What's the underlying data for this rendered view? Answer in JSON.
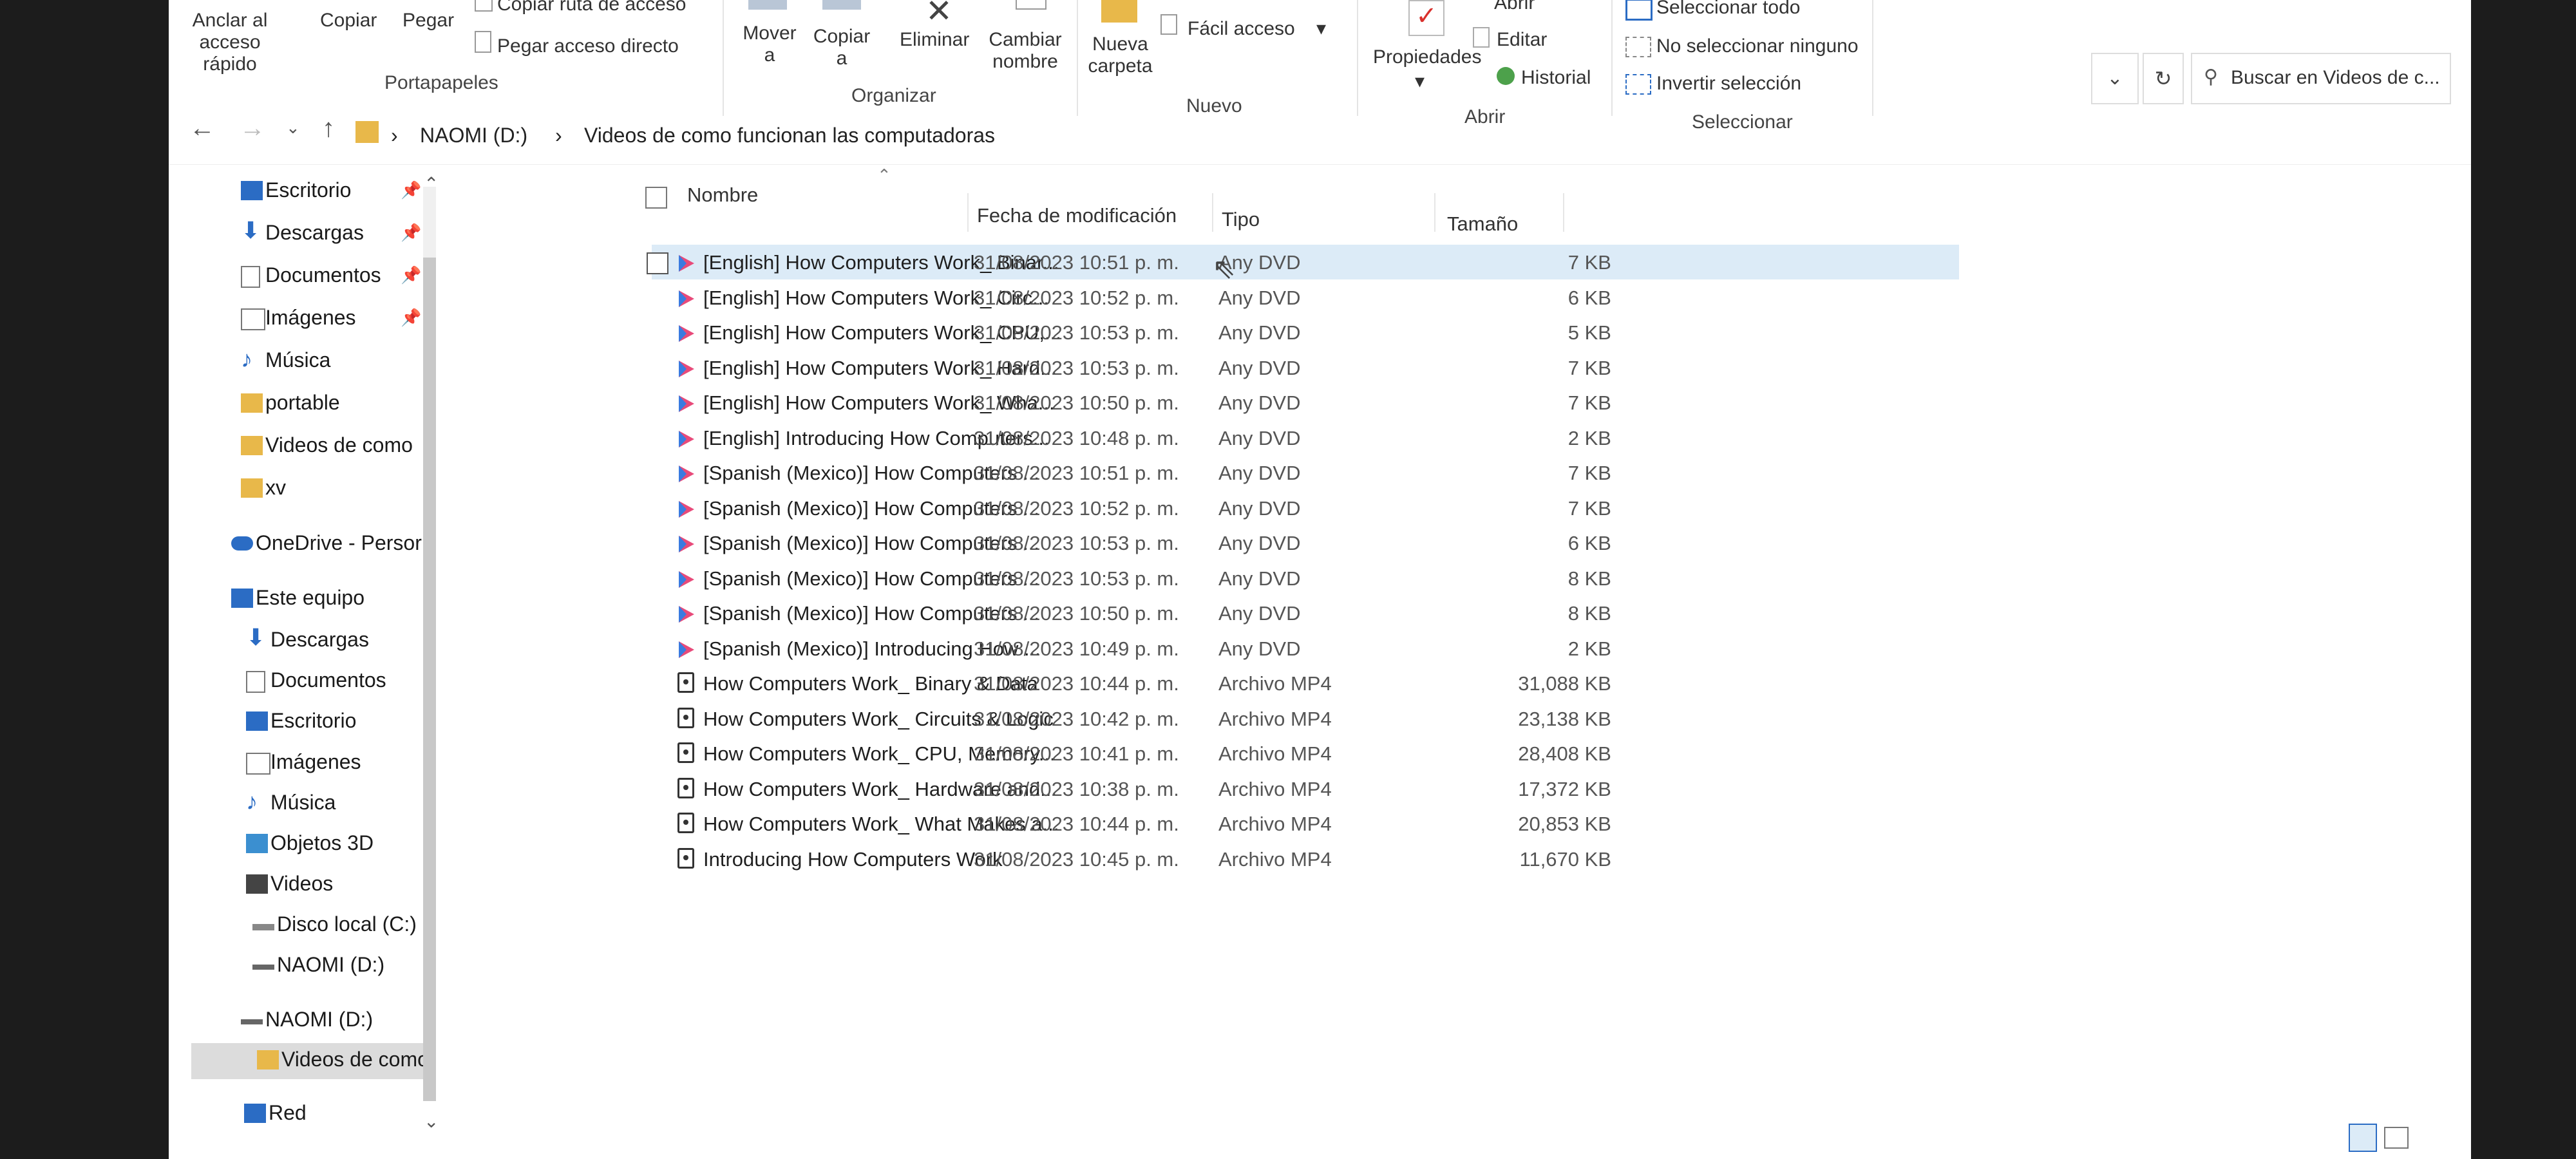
{
  "ribbon": {
    "portapapeles": {
      "anclar": "Anclar al acceso rápido",
      "copiar": "Copiar",
      "pegar": "Pegar",
      "copiar_ruta": "Copiar ruta de acceso",
      "pegar_acceso": "Pegar acceso directo",
      "group": "Portapapeles"
    },
    "organizar": {
      "mover": "Mover a",
      "copiar_a": "Copiar a",
      "eliminar": "Eliminar",
      "cambiar": "Cambiar nombre",
      "group": "Organizar"
    },
    "nuevo": {
      "nueva_carpeta": "Nueva carpeta",
      "facil_acceso": "Fácil acceso",
      "group": "Nuevo"
    },
    "abrir": {
      "propiedades": "Propiedades",
      "abrir": "Abrir",
      "editar": "Editar",
      "historial": "Historial",
      "group": "Abrir"
    },
    "seleccionar": {
      "todo": "Seleccionar todo",
      "ninguno": "No seleccionar ninguno",
      "invertir": "Invertir selección",
      "group": "Seleccionar"
    }
  },
  "address": {
    "drive": "NAOMI (D:)",
    "folder": "Videos de como funcionan las computadoras",
    "search_placeholder": "Buscar en Videos de c..."
  },
  "nav": [
    {
      "label": "Escritorio",
      "icon": "desktop-icon",
      "pinned": true
    },
    {
      "label": "Descargas",
      "icon": "download-icon",
      "pinned": true
    },
    {
      "label": "Documentos",
      "icon": "document-icon",
      "pinned": true
    },
    {
      "label": "Imágenes",
      "icon": "image-icon",
      "pinned": true
    },
    {
      "label": "Música",
      "icon": "music-icon"
    },
    {
      "label": "portable",
      "icon": "folder-icon"
    },
    {
      "label": "Videos de como",
      "icon": "folder-icon"
    },
    {
      "label": "xv",
      "icon": "folder-icon"
    },
    {
      "label": "OneDrive - Persor",
      "icon": "cloud-icon"
    },
    {
      "label": "Este equipo",
      "icon": "computer-icon"
    },
    {
      "label": "Descargas",
      "icon": "download-icon"
    },
    {
      "label": "Documentos",
      "icon": "document-icon"
    },
    {
      "label": "Escritorio",
      "icon": "desktop-icon"
    },
    {
      "label": "Imágenes",
      "icon": "image-icon"
    },
    {
      "label": "Música",
      "icon": "music-icon"
    },
    {
      "label": "Objetos 3D",
      "icon": "cube-icon"
    },
    {
      "label": "Videos",
      "icon": "video-icon"
    },
    {
      "label": "Disco local (C:)",
      "icon": "drive-icon"
    },
    {
      "label": "NAOMI (D:)",
      "icon": "drive-icon"
    },
    {
      "label": "NAOMI (D:)",
      "icon": "drive-icon"
    },
    {
      "label": "Videos de como",
      "icon": "folder-icon"
    },
    {
      "label": "Red",
      "icon": "network-icon"
    }
  ],
  "columns": {
    "name": "Nombre",
    "date": "Fecha de modificación",
    "type": "Tipo",
    "size": "Tamaño"
  },
  "files": [
    {
      "name": "[English] How Computers Work_ Binar...",
      "date": "31/08/2023 10:51 p. m.",
      "type": "Any DVD",
      "size": "7 KB",
      "kind": "dvd"
    },
    {
      "name": "[English] How Computers Work_ Circ...",
      "date": "31/08/2023 10:52 p. m.",
      "type": "Any DVD",
      "size": "6 KB",
      "kind": "dvd"
    },
    {
      "name": "[English] How Computers Work_ CPU,...",
      "date": "31/08/2023 10:53 p. m.",
      "type": "Any DVD",
      "size": "5 KB",
      "kind": "dvd"
    },
    {
      "name": "[English] How Computers Work_ Hard...",
      "date": "31/08/2023 10:53 p. m.",
      "type": "Any DVD",
      "size": "7 KB",
      "kind": "dvd"
    },
    {
      "name": "[English] How Computers Work_ Wha...",
      "date": "31/08/2023 10:50 p. m.",
      "type": "Any DVD",
      "size": "7 KB",
      "kind": "dvd"
    },
    {
      "name": "[English] Introducing How Computers...",
      "date": "31/08/2023 10:48 p. m.",
      "type": "Any DVD",
      "size": "2 KB",
      "kind": "dvd"
    },
    {
      "name": "[Spanish (Mexico)] How Computers ...",
      "date": "31/08/2023 10:51 p. m.",
      "type": "Any DVD",
      "size": "7 KB",
      "kind": "dvd"
    },
    {
      "name": "[Spanish (Mexico)] How Computers ...",
      "date": "31/08/2023 10:52 p. m.",
      "type": "Any DVD",
      "size": "7 KB",
      "kind": "dvd"
    },
    {
      "name": "[Spanish (Mexico)] How Computers ...",
      "date": "31/08/2023 10:53 p. m.",
      "type": "Any DVD",
      "size": "6 KB",
      "kind": "dvd"
    },
    {
      "name": "[Spanish (Mexico)] How Computers ...",
      "date": "31/08/2023 10:53 p. m.",
      "type": "Any DVD",
      "size": "8 KB",
      "kind": "dvd"
    },
    {
      "name": "[Spanish (Mexico)] How Computers ...",
      "date": "31/08/2023 10:50 p. m.",
      "type": "Any DVD",
      "size": "8 KB",
      "kind": "dvd"
    },
    {
      "name": "[Spanish (Mexico)] Introducing How ...",
      "date": "31/08/2023 10:49 p. m.",
      "type": "Any DVD",
      "size": "2 KB",
      "kind": "dvd"
    },
    {
      "name": "How Computers Work_ Binary & Data",
      "date": "31/08/2023 10:44 p. m.",
      "type": "Archivo MP4",
      "size": "31,088 KB",
      "kind": "mp4"
    },
    {
      "name": "How Computers Work_ Circuits & Logic",
      "date": "31/08/2023 10:42 p. m.",
      "type": "Archivo MP4",
      "size": "23,138 KB",
      "kind": "mp4"
    },
    {
      "name": "How Computers Work_ CPU, Memory...",
      "date": "31/08/2023 10:41 p. m.",
      "type": "Archivo MP4",
      "size": "28,408 KB",
      "kind": "mp4"
    },
    {
      "name": "How Computers Work_ Hardware and...",
      "date": "31/08/2023 10:38 p. m.",
      "type": "Archivo MP4",
      "size": "17,372 KB",
      "kind": "mp4"
    },
    {
      "name": "How Computers Work_ What Makes a...",
      "date": "31/08/2023 10:44 p. m.",
      "type": "Archivo MP4",
      "size": "20,853 KB",
      "kind": "mp4"
    },
    {
      "name": "Introducing How Computers Work",
      "date": "31/08/2023 10:45 p. m.",
      "type": "Archivo MP4",
      "size": "11,670 KB",
      "kind": "mp4"
    }
  ]
}
